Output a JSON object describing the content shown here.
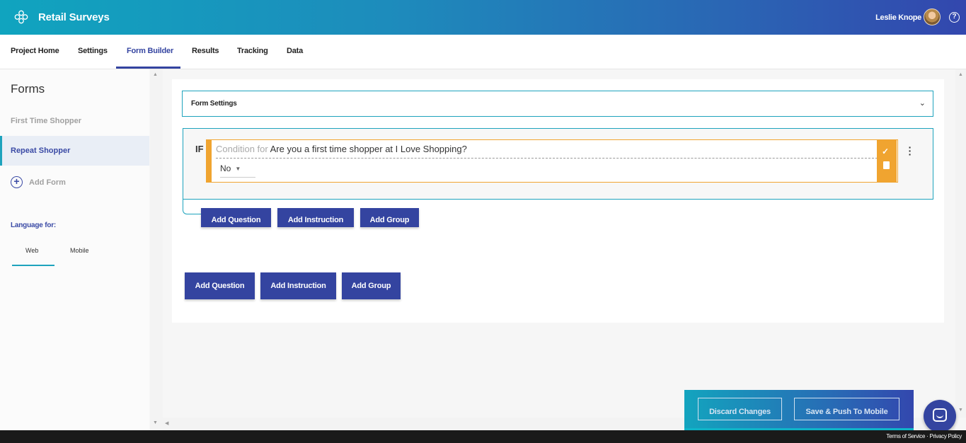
{
  "header": {
    "app_title": "Retail Surveys",
    "user_name": "Leslie Knope",
    "help_glyph": "?",
    "logo_icon": "flower-logo-icon",
    "colors": {
      "gradient_start": "#10a4bf",
      "gradient_end": "#3347ae"
    }
  },
  "nav": {
    "items": [
      {
        "label": "Project Home"
      },
      {
        "label": "Settings"
      },
      {
        "label": "Form Builder",
        "active": true
      },
      {
        "label": "Results"
      },
      {
        "label": "Tracking"
      },
      {
        "label": "Data"
      }
    ],
    "accent": "#3444a0"
  },
  "sidebar": {
    "title": "Forms",
    "forms": [
      {
        "label": "First Time Shopper"
      },
      {
        "label": "Repeat Shopper",
        "active": true
      }
    ],
    "add_form_label": "Add Form",
    "language_label": "Language for:",
    "language_tabs": [
      {
        "label": "Web",
        "active": true
      },
      {
        "label": "Mobile"
      }
    ]
  },
  "form_settings": {
    "label": "Form Settings",
    "chevron_glyph": "⌄"
  },
  "condition": {
    "if_label": "IF",
    "prefix": "Condition for",
    "question": "Are you a first time shopper at I Love Shopping?",
    "selected_value": "No",
    "check_glyph": "✓",
    "accent": "#f0a430"
  },
  "group_buttons": {
    "add_question": "Add Question",
    "add_instruction": "Add Instruction",
    "add_group": "Add Group"
  },
  "form_buttons": {
    "add_question": "Add Question",
    "add_instruction": "Add Instruction",
    "add_group": "Add Group"
  },
  "bottom_bar": {
    "discard_label": "Discard Changes",
    "save_push_label": "Save & Push To Mobile"
  },
  "footer": {
    "terms": "Terms of Service",
    "separator": "·",
    "privacy": "Privacy Policy"
  }
}
